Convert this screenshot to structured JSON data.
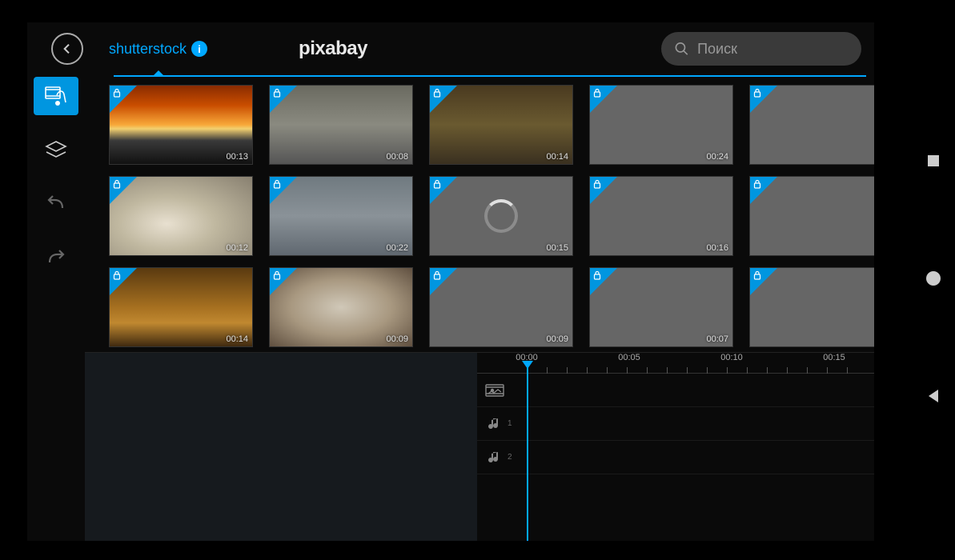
{
  "header": {
    "tabs": {
      "shutterstock": "shutterstock",
      "pixabay": "pixabay"
    },
    "info_glyph": "i"
  },
  "search": {
    "placeholder": "Поиск"
  },
  "sidebar": {
    "items": [
      "media",
      "layers",
      "undo",
      "redo"
    ]
  },
  "clips": [
    {
      "duration": "00:13",
      "thumb": "thumb-sunset",
      "loading": false,
      "placeholder": false
    },
    {
      "duration": "00:08",
      "thumb": "thumb-factory",
      "loading": false,
      "placeholder": false
    },
    {
      "duration": "00:14",
      "thumb": "thumb-robot",
      "loading": false,
      "placeholder": false
    },
    {
      "duration": "00:24",
      "thumb": "",
      "loading": false,
      "placeholder": true
    },
    {
      "duration": "",
      "thumb": "",
      "loading": false,
      "placeholder": true
    },
    {
      "duration": "00:12",
      "thumb": "thumb-typing",
      "loading": false,
      "placeholder": false
    },
    {
      "duration": "00:22",
      "thumb": "thumb-station",
      "loading": false,
      "placeholder": false
    },
    {
      "duration": "00:15",
      "thumb": "",
      "loading": true,
      "placeholder": true
    },
    {
      "duration": "00:16",
      "thumb": "",
      "loading": false,
      "placeholder": true
    },
    {
      "duration": "",
      "thumb": "",
      "loading": false,
      "placeholder": true
    },
    {
      "duration": "00:14",
      "thumb": "thumb-savanna",
      "loading": false,
      "placeholder": false
    },
    {
      "duration": "00:09",
      "thumb": "thumb-phone",
      "loading": false,
      "placeholder": false
    },
    {
      "duration": "00:09",
      "thumb": "",
      "loading": false,
      "placeholder": true
    },
    {
      "duration": "00:07",
      "thumb": "",
      "loading": false,
      "placeholder": true
    },
    {
      "duration": "",
      "thumb": "",
      "loading": false,
      "placeholder": true
    }
  ],
  "timeline": {
    "marks": [
      "00:00",
      "00:05",
      "00:10",
      "00:15"
    ],
    "tracks": [
      {
        "type": "video",
        "label": ""
      },
      {
        "type": "audio",
        "label": "1"
      },
      {
        "type": "audio",
        "label": "2"
      }
    ]
  },
  "colors": {
    "accent": "#00a8ff"
  }
}
